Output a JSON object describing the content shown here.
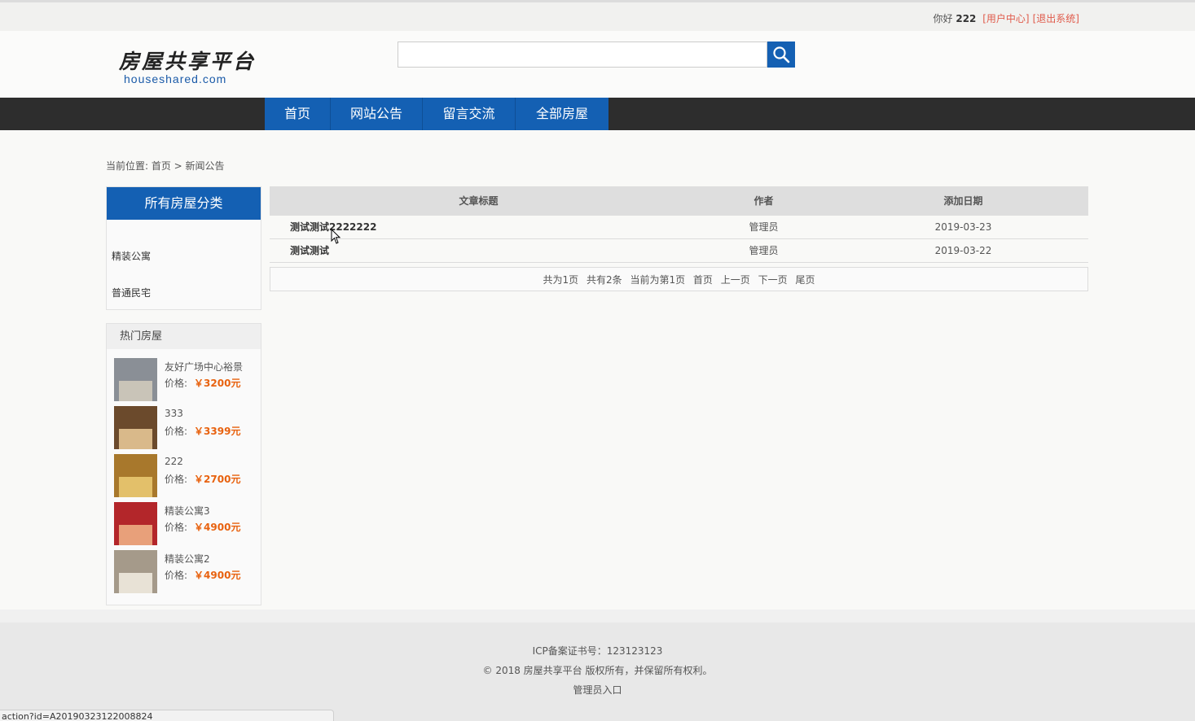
{
  "topbar": {
    "greeting": "你好",
    "username": "222",
    "user_center": "[用户中心]",
    "logout": "[退出系统]"
  },
  "logo": {
    "cn": "房屋共享平台",
    "en": "houseshared.com"
  },
  "search": {
    "value": "",
    "icon": "search-icon"
  },
  "nav": [
    "首页",
    "网站公告",
    "留言交流",
    "全部房屋"
  ],
  "breadcrumb": {
    "text": "当前位置: 首页 > 新闻公告"
  },
  "categories": {
    "title": "所有房屋分类",
    "items": [
      "精装公寓",
      "普通民宅"
    ]
  },
  "hot": {
    "title": "热门房屋",
    "price_label": "价格:",
    "items": [
      {
        "name": "友好广场中心裕景",
        "price": "￥3200元",
        "colors": [
          "#8a8f96",
          "#c9c4b8"
        ]
      },
      {
        "name": "333",
        "price": "￥3399元",
        "colors": [
          "#6b4a2c",
          "#d9b98a"
        ]
      },
      {
        "name": "222",
        "price": "￥2700元",
        "colors": [
          "#a8782c",
          "#e3c06a"
        ]
      },
      {
        "name": "精装公寓3",
        "price": "￥4900元",
        "colors": [
          "#b3262a",
          "#e8a07a"
        ]
      },
      {
        "name": "精装公寓2",
        "price": "￥4900元",
        "colors": [
          "#a59a8a",
          "#e8e2d6"
        ]
      }
    ]
  },
  "table": {
    "headers": [
      "文章标题",
      "作者",
      "添加日期"
    ],
    "rows": [
      {
        "title": "测试测试2222222",
        "author": "管理员",
        "date": "2019-03-23"
      },
      {
        "title": "测试测试",
        "author": "管理员",
        "date": "2019-03-22"
      }
    ],
    "pager": [
      "共为1页",
      "共有2条",
      "当前为第1页",
      "首页",
      "上一页",
      "下一页",
      "尾页"
    ]
  },
  "footer": {
    "icp": "ICP备案证书号：123123123",
    "copyright": "© 2018 房屋共享平台 版权所有，并保留所有权利。",
    "admin": "管理员入口"
  },
  "statusbar": {
    "url": "action?id=A20190323122008824"
  }
}
